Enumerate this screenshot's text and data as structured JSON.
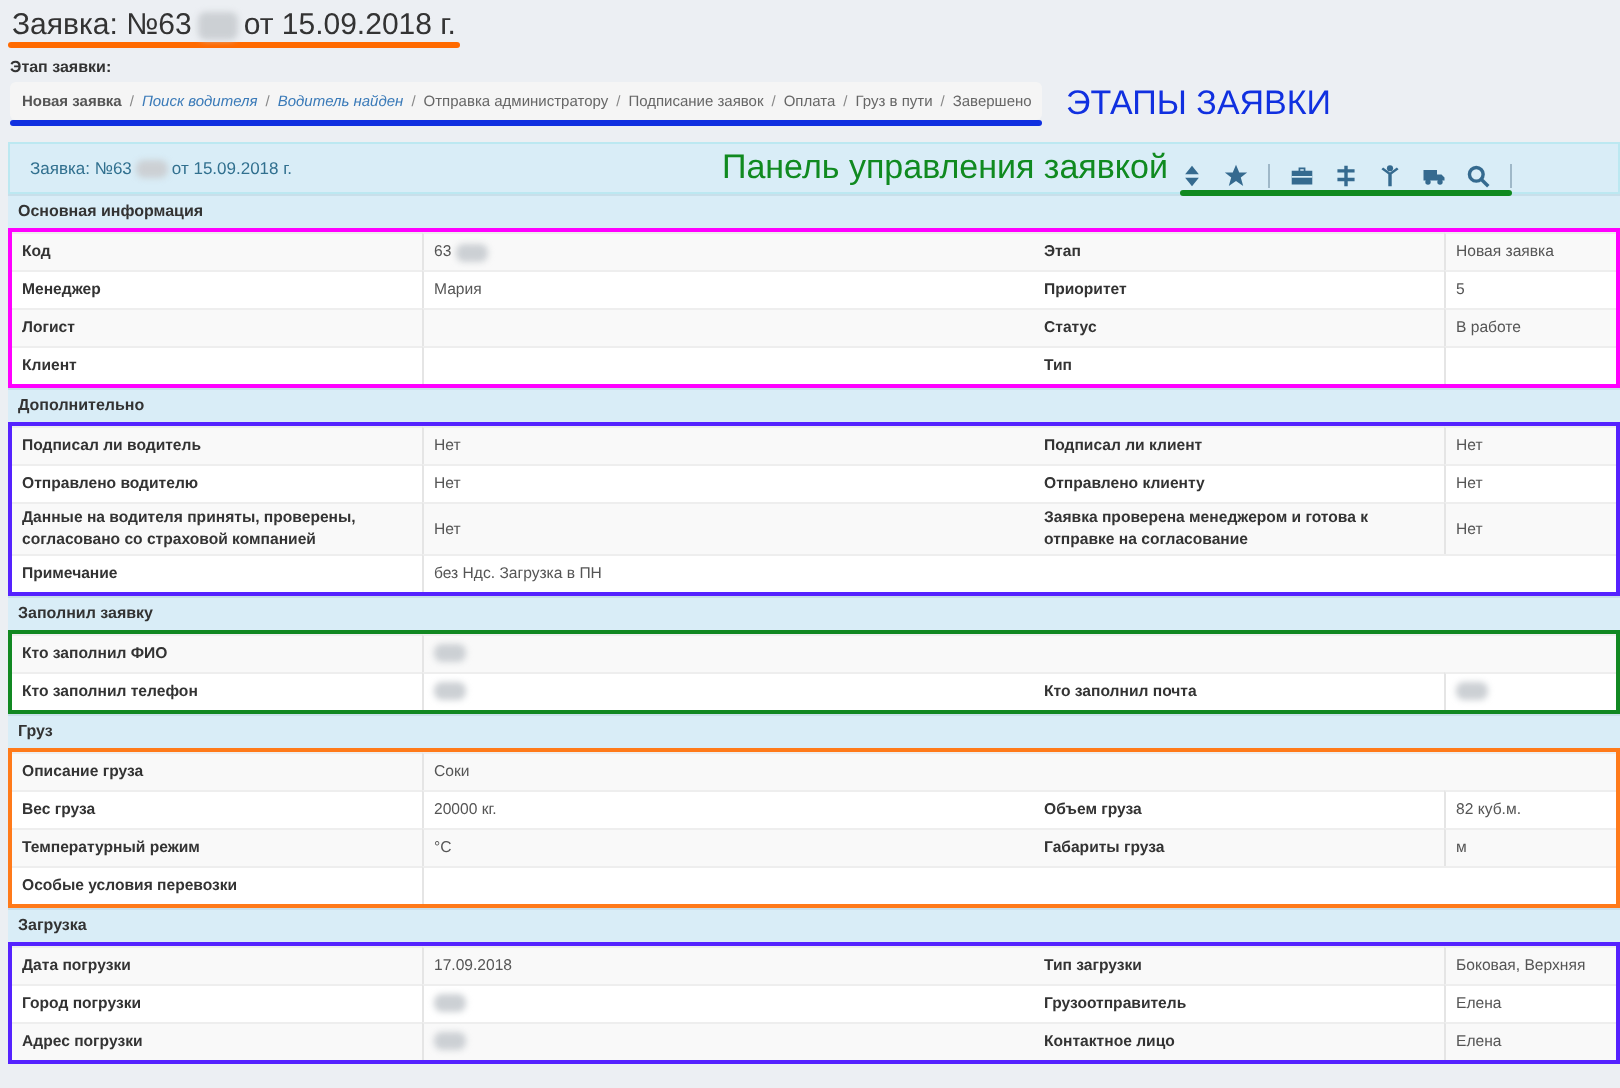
{
  "title": {
    "prefix": "Заявка: №63",
    "suffix": "от 15.09.2018 г.",
    "blurred": true
  },
  "stage_label": "Этап заявки:",
  "stage_separator": "/",
  "stages": [
    {
      "label": "Новая заявка",
      "kind": "current"
    },
    {
      "label": "Поиск водителя",
      "kind": "done"
    },
    {
      "label": "Водитель найден",
      "kind": "done"
    },
    {
      "label": "Отправка администратору",
      "kind": "pending"
    },
    {
      "label": "Подписание заявок",
      "kind": "pending"
    },
    {
      "label": "Оплата",
      "kind": "pending"
    },
    {
      "label": "Груз в пути",
      "kind": "pending"
    },
    {
      "label": "Завершено",
      "kind": "pending"
    }
  ],
  "stages_annotation": "ЭТАПЫ ЗАЯВКИ",
  "panel": {
    "prefix": "Заявка: №63",
    "suffix": "от 15.09.2018 г.",
    "blurred": true,
    "annotation": "Панель управления заявкой"
  },
  "toolbar": [
    {
      "kind": "sort"
    },
    {
      "kind": "star"
    },
    {
      "kind": "briefcase"
    },
    {
      "kind": "signpost"
    },
    {
      "kind": "person"
    },
    {
      "kind": "truck"
    },
    {
      "kind": "search"
    }
  ],
  "sections": [
    {
      "title": "Основная информация",
      "color": "#ff00ff",
      "rows": [
        {
          "cells": [
            {
              "label": "Код",
              "value": "63",
              "blurred": true
            },
            {
              "label": "Этап",
              "value": "Новая заявка"
            }
          ]
        },
        {
          "cells": [
            {
              "label": "Менеджер",
              "value": "Мария"
            },
            {
              "label": "Приоритет",
              "value": "5"
            }
          ]
        },
        {
          "cells": [
            {
              "label": "Логист"
            },
            {
              "label": "Статус",
              "value": "В работе"
            }
          ]
        },
        {
          "cells": [
            {
              "label": "Клиент"
            },
            {
              "label": "Тип"
            }
          ]
        }
      ]
    },
    {
      "title": "Дополнительно",
      "color": "#5522ff",
      "rows": [
        {
          "cells": [
            {
              "label": "Подписал ли водитель",
              "value": "Нет"
            },
            {
              "label": "Подписал ли клиент",
              "value": "Нет"
            }
          ]
        },
        {
          "cells": [
            {
              "label": "Отправлено водителю",
              "value": "Нет"
            },
            {
              "label": "Отправлено клиенту",
              "value": "Нет"
            }
          ]
        },
        {
          "cells": [
            {
              "label": "Данные на водителя приняты, проверены, согласовано со страховой компанией",
              "value": "Нет"
            },
            {
              "label": "Заявка проверена менеджером и готова к отправке на согласование",
              "value": "Нет"
            }
          ]
        },
        {
          "cells": [
            {
              "label": "Примечание",
              "value": "без Ндс. Загрузка в ПН"
            }
          ]
        }
      ]
    },
    {
      "title": "Заполнил заявку",
      "color": "#118822",
      "rows": [
        {
          "cells": [
            {
              "label": "Кто заполнил ФИО",
              "blurred": true
            }
          ]
        },
        {
          "cells": [
            {
              "label": "Кто заполнил телефон",
              "blurred": true
            },
            {
              "label": "Кто заполнил почта",
              "blurred": true
            }
          ]
        }
      ]
    },
    {
      "title": "Груз",
      "color": "#ff7a1a",
      "rows": [
        {
          "cells": [
            {
              "label": "Описание груза",
              "value": "Соки"
            }
          ]
        },
        {
          "cells": [
            {
              "label": "Вес груза",
              "value": "20000 кг."
            },
            {
              "label": "Объем груза",
              "value": "82 куб.м."
            }
          ]
        },
        {
          "cells": [
            {
              "label": "Температурный режим",
              "value": "°C"
            },
            {
              "label": "Габариты груза",
              "value": "м"
            }
          ]
        },
        {
          "cells": [
            {
              "label": "Особые условия перевозки"
            }
          ]
        }
      ]
    },
    {
      "title": "Загрузка",
      "color": "#5522ff",
      "rows": [
        {
          "cells": [
            {
              "label": "Дата погрузки",
              "value": "17.09.2018"
            },
            {
              "label": "Тип загрузки",
              "value": "Боковая, Верхняя"
            }
          ]
        },
        {
          "cells": [
            {
              "label": "Город погрузки",
              "blurred": true
            },
            {
              "label": "Грузоотправитель",
              "value": "Елена"
            }
          ]
        },
        {
          "cells": [
            {
              "label": "Адрес погрузки",
              "blurred": true
            },
            {
              "label": "Контактное лицо",
              "value": "Елена"
            }
          ]
        }
      ]
    }
  ]
}
